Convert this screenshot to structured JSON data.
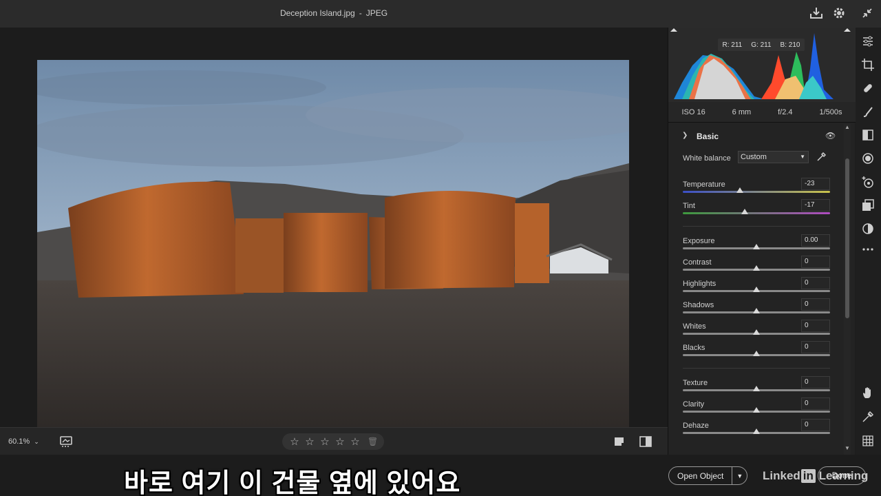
{
  "window": {
    "file_name": "Deception Island.jpg",
    "separator": "-",
    "file_type": "JPEG"
  },
  "canvas": {
    "zoom": "60.1%"
  },
  "rating": {
    "stars_total": 5
  },
  "histogram": {
    "r": "R: 211",
    "g": "G: 211",
    "b": "B: 210"
  },
  "exif": {
    "iso": "ISO 16",
    "focal": "6 mm",
    "aperture": "f/2.4",
    "shutter": "1/500s"
  },
  "basic": {
    "title": "Basic",
    "white_balance_label": "White balance",
    "white_balance_value": "Custom",
    "sliders": [
      {
        "label": "Temperature",
        "value": "-23",
        "pos": 0.39
      },
      {
        "label": "Tint",
        "value": "-17",
        "pos": 0.42
      },
      {
        "label": "Exposure",
        "value": "0.00",
        "pos": 0.5
      },
      {
        "label": "Contrast",
        "value": "0",
        "pos": 0.5
      },
      {
        "label": "Highlights",
        "value": "0",
        "pos": 0.5
      },
      {
        "label": "Shadows",
        "value": "0",
        "pos": 0.5
      },
      {
        "label": "Whites",
        "value": "0",
        "pos": 0.5
      },
      {
        "label": "Blacks",
        "value": "0",
        "pos": 0.5
      },
      {
        "label": "Texture",
        "value": "0",
        "pos": 0.5
      },
      {
        "label": "Clarity",
        "value": "0",
        "pos": 0.5
      },
      {
        "label": "Dehaze",
        "value": "0",
        "pos": 0.5
      }
    ]
  },
  "footer": {
    "open_button": "Open Object",
    "done_button": "Done",
    "subtitle": "바로 여기 이 건물 옆에 있어요",
    "brand_a": "Linked",
    "brand_b": "in",
    "brand_c": "Learning"
  },
  "colors": {
    "accent": "#e0e0e0",
    "panel_bg": "#232323"
  }
}
